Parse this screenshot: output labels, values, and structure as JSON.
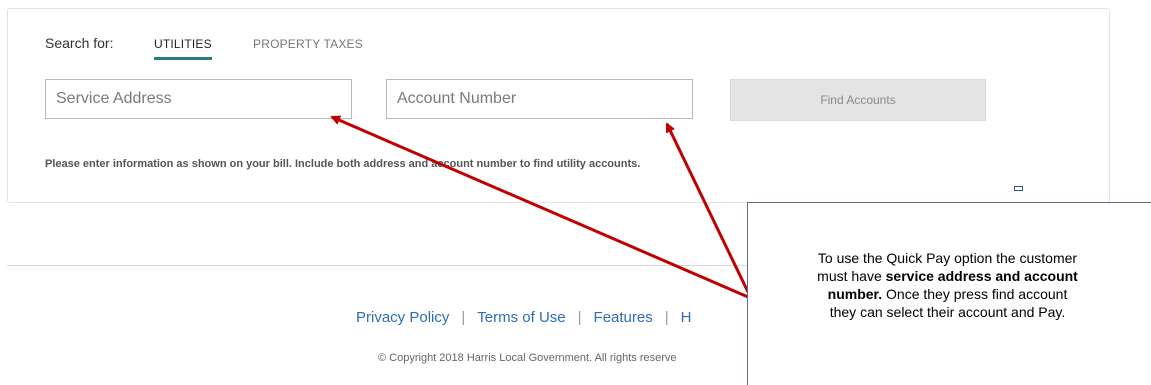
{
  "search": {
    "label": "Search for:",
    "tabs": [
      {
        "label": "UTILITIES",
        "active": true
      },
      {
        "label": "PROPERTY TAXES",
        "active": false
      }
    ],
    "service_address_placeholder": "Service Address",
    "account_number_placeholder": "Account Number",
    "find_button_label": "Find Accounts",
    "hint": "Please enter information as shown on your bill. Include both address and account number to find utility accounts."
  },
  "footer": {
    "links": [
      "Privacy Policy",
      "Terms of Use",
      "Features",
      "H"
    ],
    "copyright": "© Copyright 2018 Harris Local Government. All rights reserve"
  },
  "callout": {
    "line1": "To use the Quick Pay option the customer",
    "line2_prefix": "must have ",
    "line2_bold": "service address and account",
    "line3_bold": "number.",
    "line3_rest": " Once they press find account",
    "line4": "they can select their account and Pay."
  },
  "colors": {
    "accent_tab_underline": "#2a7d7a",
    "link": "#2a6fb5",
    "arrow": "#c00000",
    "callout_border": "#5a6f8c"
  }
}
